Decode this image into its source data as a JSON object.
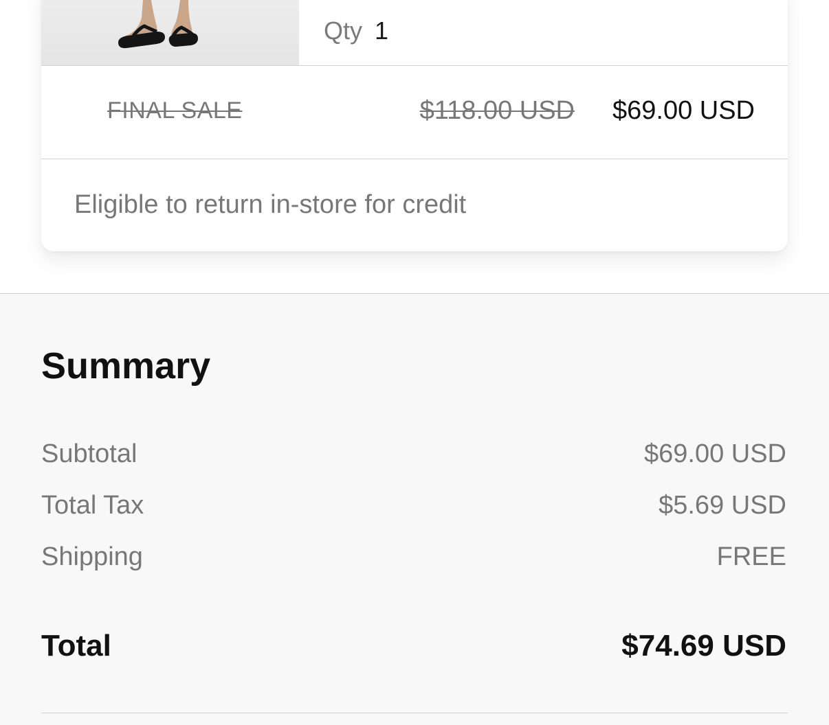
{
  "item": {
    "qty_label": "Qty",
    "qty_value": "1",
    "final_sale_label": "FINAL SALE",
    "original_price": "$118.00 USD",
    "sale_price": "$69.00 USD",
    "return_note": "Eligible to return in-store for credit"
  },
  "summary": {
    "title": "Summary",
    "rows": [
      {
        "label": "Subtotal",
        "value": "$69.00 USD"
      },
      {
        "label": "Total Tax",
        "value": "$5.69 USD"
      },
      {
        "label": "Shipping",
        "value": "FREE"
      }
    ],
    "total_label": "Total",
    "total_value": "$74.69 USD"
  }
}
